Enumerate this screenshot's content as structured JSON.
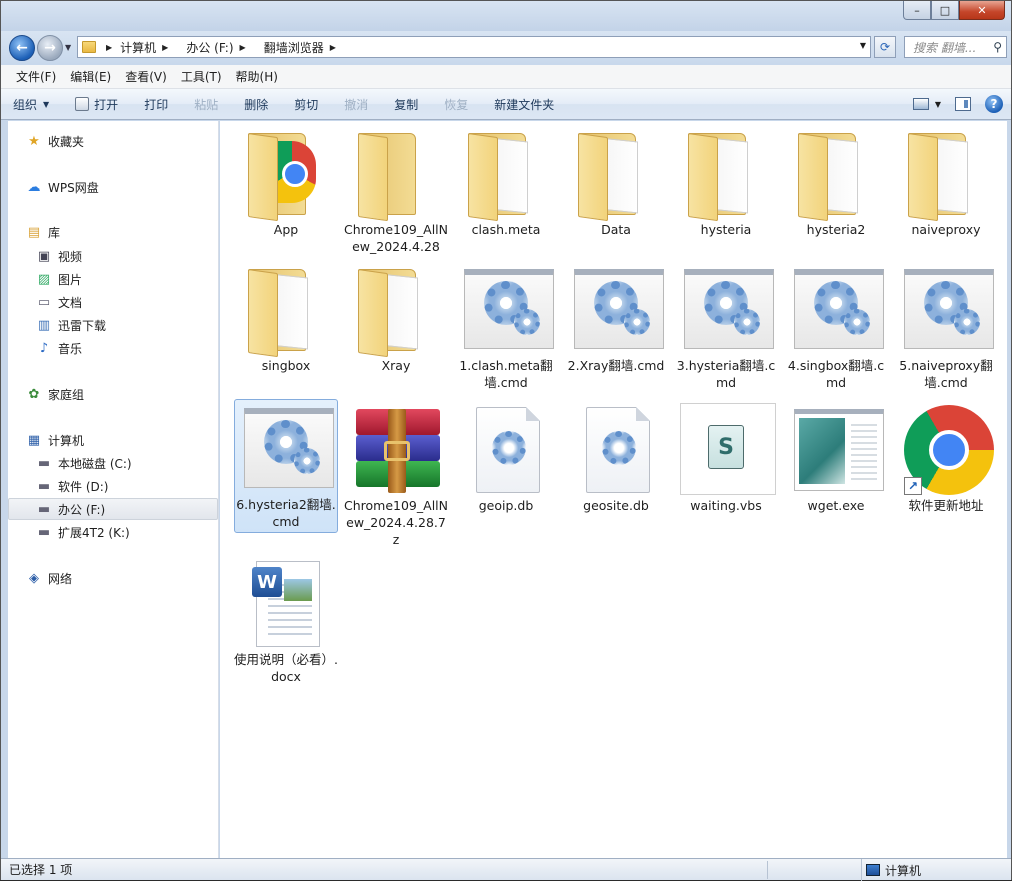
{
  "window": {
    "caption": {
      "minimize": "–",
      "maximize": "□",
      "close": "✕"
    }
  },
  "address": {
    "crumbs": [
      "计算机",
      "办公 (F:)",
      "翻墙浏览器"
    ]
  },
  "search": {
    "placeholder": "搜索 翻墙..."
  },
  "menubar": [
    "文件(F)",
    "编辑(E)",
    "查看(V)",
    "工具(T)",
    "帮助(H)"
  ],
  "toolbar": {
    "organize": "组织",
    "open": "打开",
    "print": "打印",
    "paste": "粘贴",
    "delete": "删除",
    "cut": "剪切",
    "undo": "撤消",
    "copy": "复制",
    "redo": "恢复",
    "new_folder": "新建文件夹"
  },
  "sidebar": {
    "favorites": "收藏夹",
    "wps": "WPS网盘",
    "library": "库",
    "library_items": [
      "视频",
      "图片",
      "文档",
      "迅雷下载",
      "音乐"
    ],
    "homegroup": "家庭组",
    "computer": "计算机",
    "drives": [
      "本地磁盘 (C:)",
      "软件 (D:)",
      "办公 (F:)",
      "扩展4T2 (K:)"
    ],
    "network": "网络"
  },
  "files": [
    {
      "name": "App",
      "type": "folder-chrome"
    },
    {
      "name": "Chrome109_AllNew_2024.4.28",
      "type": "folder"
    },
    {
      "name": "clash.meta",
      "type": "folder"
    },
    {
      "name": "Data",
      "type": "folder"
    },
    {
      "name": "hysteria",
      "type": "folder"
    },
    {
      "name": "hysteria2",
      "type": "folder"
    },
    {
      "name": "naiveproxy",
      "type": "folder"
    },
    {
      "name": "singbox",
      "type": "folder"
    },
    {
      "name": "Xray",
      "type": "folder"
    },
    {
      "name": "1.clash.meta翻墙.cmd",
      "type": "cmd"
    },
    {
      "name": "2.Xray翻墙.cmd",
      "type": "cmd"
    },
    {
      "name": "3.hysteria翻墙.cmd",
      "type": "cmd"
    },
    {
      "name": "4.singbox翻墙.cmd",
      "type": "cmd"
    },
    {
      "name": "5.naiveproxy翻墙.cmd",
      "type": "cmd"
    },
    {
      "name": "6.hysteria2翻墙.cmd",
      "type": "cmd",
      "selected": true
    },
    {
      "name": "Chrome109_AllNew_2024.4.28.7z",
      "type": "rar"
    },
    {
      "name": "geoip.db",
      "type": "db"
    },
    {
      "name": "geosite.db",
      "type": "db"
    },
    {
      "name": "waiting.vbs",
      "type": "vbs"
    },
    {
      "name": "wget.exe",
      "type": "exe"
    },
    {
      "name": "软件更新地址",
      "type": "chrome-shortcut"
    },
    {
      "name": "使用说明（必看）.docx",
      "type": "docx"
    }
  ],
  "status": {
    "selection": "已选择 1 项",
    "location": "计算机"
  }
}
